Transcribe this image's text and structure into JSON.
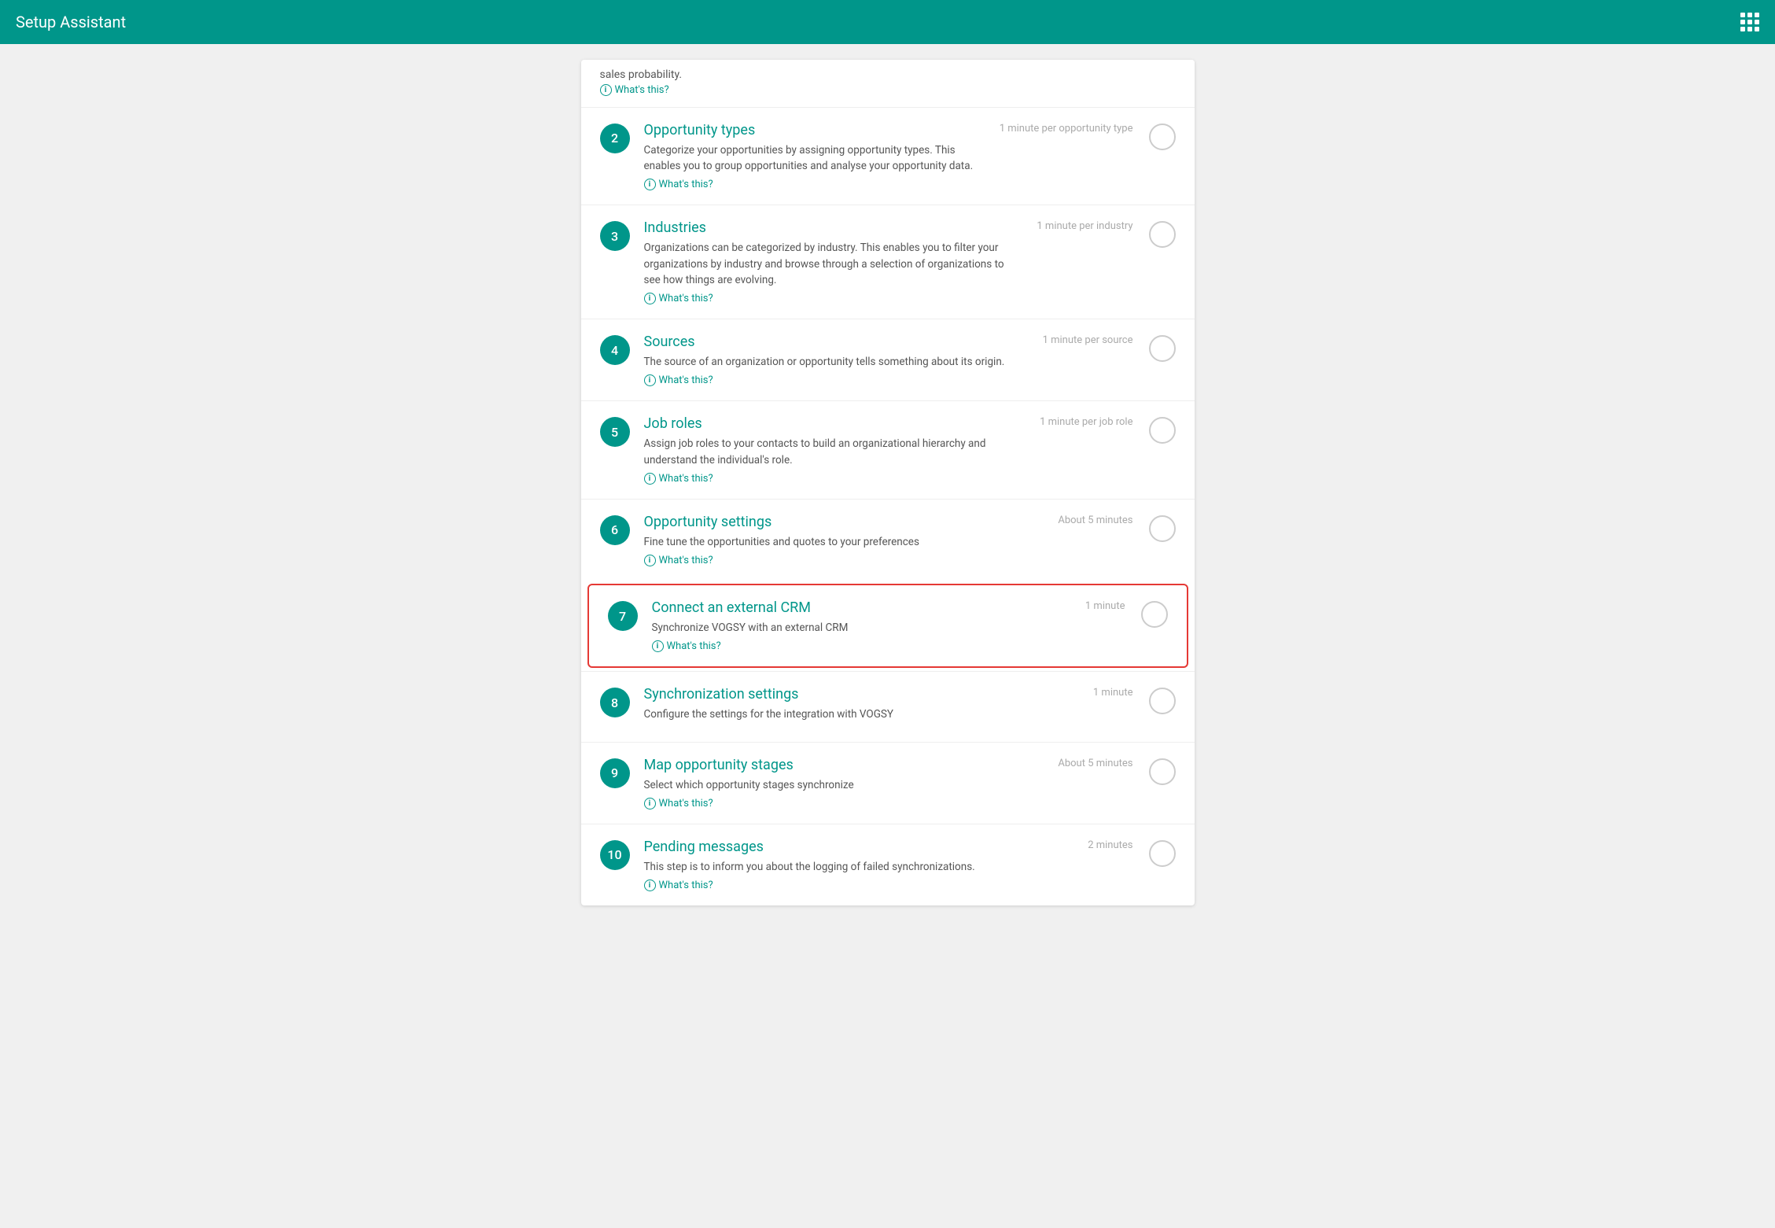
{
  "header": {
    "title": "Setup Assistant",
    "grid_icon": "grid-icon"
  },
  "top_partial": {
    "text": "sales probability.",
    "whats_this": "What's this?"
  },
  "items": [
    {
      "step": "2",
      "title": "Opportunity types",
      "description": "Categorize your opportunities by assigning opportunity types. This enables you to group opportunities and analyse your opportunity data.",
      "whats_this": "What's this?",
      "time": "1 minute per opportunity type",
      "highlighted": false
    },
    {
      "step": "3",
      "title": "Industries",
      "description": "Organizations can be categorized by industry. This enables you to filter your organizations by industry and browse through a selection of organizations to see how things are evolving.",
      "whats_this": "What's this?",
      "time": "1 minute per industry",
      "highlighted": false
    },
    {
      "step": "4",
      "title": "Sources",
      "description": "The source of an organization or opportunity tells something about its origin.",
      "whats_this": "What's this?",
      "time": "1 minute per source",
      "highlighted": false
    },
    {
      "step": "5",
      "title": "Job roles",
      "description": "Assign job roles to your contacts to build an organizational hierarchy and understand the individual's role.",
      "whats_this": "What's this?",
      "time": "1 minute per job role",
      "highlighted": false
    },
    {
      "step": "6",
      "title": "Opportunity settings",
      "description": "Fine tune the opportunities and quotes to your preferences",
      "whats_this": "What's this?",
      "time": "About 5 minutes",
      "highlighted": false
    },
    {
      "step": "7",
      "title": "Connect an external CRM",
      "description": "Synchronize VOGSY with an external CRM",
      "whats_this": "What's this?",
      "time": "1 minute",
      "highlighted": true
    },
    {
      "step": "8",
      "title": "Synchronization settings",
      "description": "Configure the settings for the integration with VOGSY",
      "whats_this": null,
      "time": "1 minute",
      "highlighted": false
    },
    {
      "step": "9",
      "title": "Map opportunity stages",
      "description": "Select which opportunity stages synchronize",
      "whats_this": "What's this?",
      "time": "About 5 minutes",
      "highlighted": false
    },
    {
      "step": "10",
      "title": "Pending messages",
      "description": "This step is to inform you about the logging of failed synchronizations.",
      "whats_this": "What's this?",
      "time": "2 minutes",
      "highlighted": false
    }
  ]
}
